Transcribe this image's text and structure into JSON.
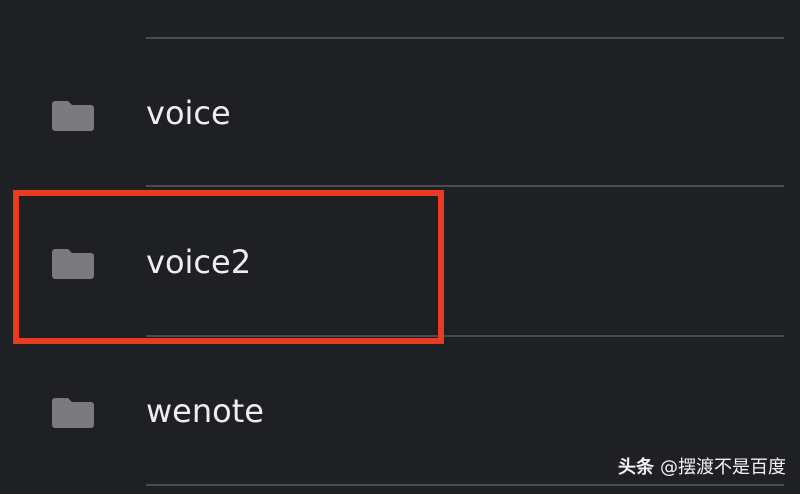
{
  "folders": [
    {
      "name": "voice",
      "icon": "folder-icon"
    },
    {
      "name": "voice2",
      "icon": "folder-icon"
    },
    {
      "name": "wenote",
      "icon": "folder-icon"
    }
  ],
  "highlight": {
    "target": "voice2",
    "color": "#e83b22"
  },
  "watermark": {
    "brand": "头条",
    "handle": "@摆渡不是百度"
  },
  "colors": {
    "background": "#1f2024",
    "folder_icon": "#7b7b7f",
    "text": "#eeeeee",
    "divider": "#4a4b50"
  }
}
